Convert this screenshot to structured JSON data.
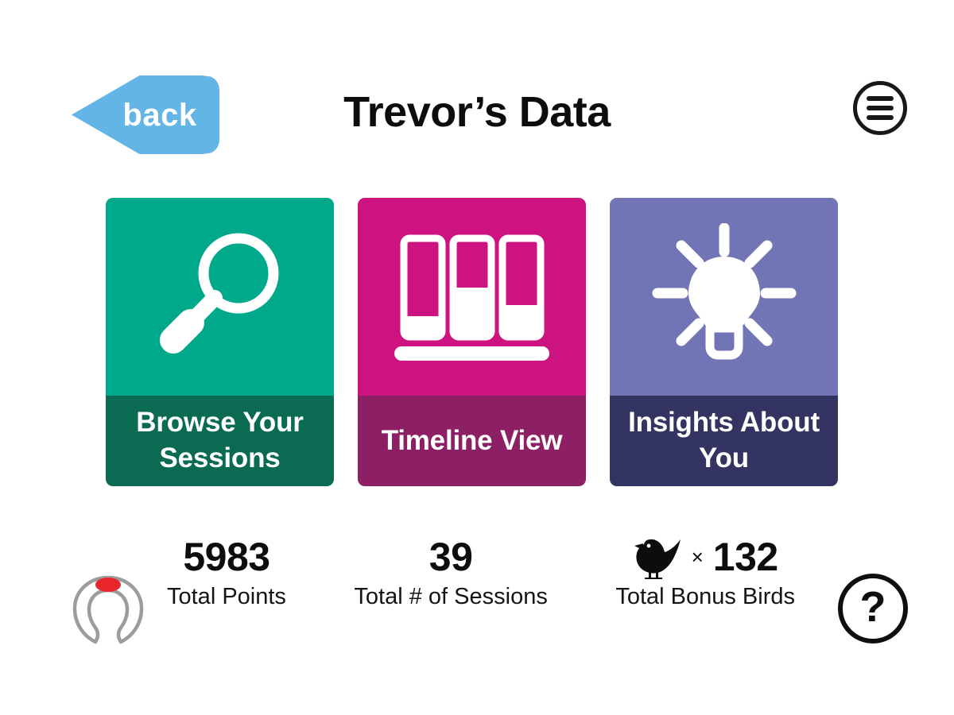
{
  "header": {
    "back_label": "back",
    "title": "Trevor’s Data",
    "menu_icon": "hamburger-menu-icon"
  },
  "cards": [
    {
      "id": "browse-your-sessions",
      "label": "Browse Your Sessions",
      "icon": "magnifying-glass-icon",
      "color_top": "#00a98a",
      "color_bottom": "#0a6b52"
    },
    {
      "id": "timeline-view",
      "label": "Timeline View",
      "icon": "bar-chart-icon",
      "color_top": "#cc1380",
      "color_bottom": "#8d2064"
    },
    {
      "id": "insights-about-you",
      "label": "Insights About You",
      "icon": "lightbulb-icon",
      "color_top": "#7275b5",
      "color_bottom": "#343462"
    }
  ],
  "stats": [
    {
      "id": "total-points",
      "value": "5983",
      "label": "Total Points",
      "icon": null,
      "times": null
    },
    {
      "id": "total-sessions",
      "value": "39",
      "label": "Total # of Sessions",
      "icon": null,
      "times": null
    },
    {
      "id": "total-bonus-birds",
      "value": "132",
      "label": "Total Bonus Birds",
      "icon": "bird-icon",
      "times": "×"
    }
  ],
  "footer": {
    "brand_logo_icon": "horseshoe-brand-logo",
    "brand_logo_accent_color": "#e8262a",
    "brand_logo_outline_color": "#9c9c9c",
    "help_label": "?",
    "help_icon": "question-mark-circle-icon"
  },
  "colors": {
    "background": "#ffffff",
    "back_button": "#62b5e5",
    "text_primary": "#0d0d0d",
    "card_text": "#ffffff"
  }
}
